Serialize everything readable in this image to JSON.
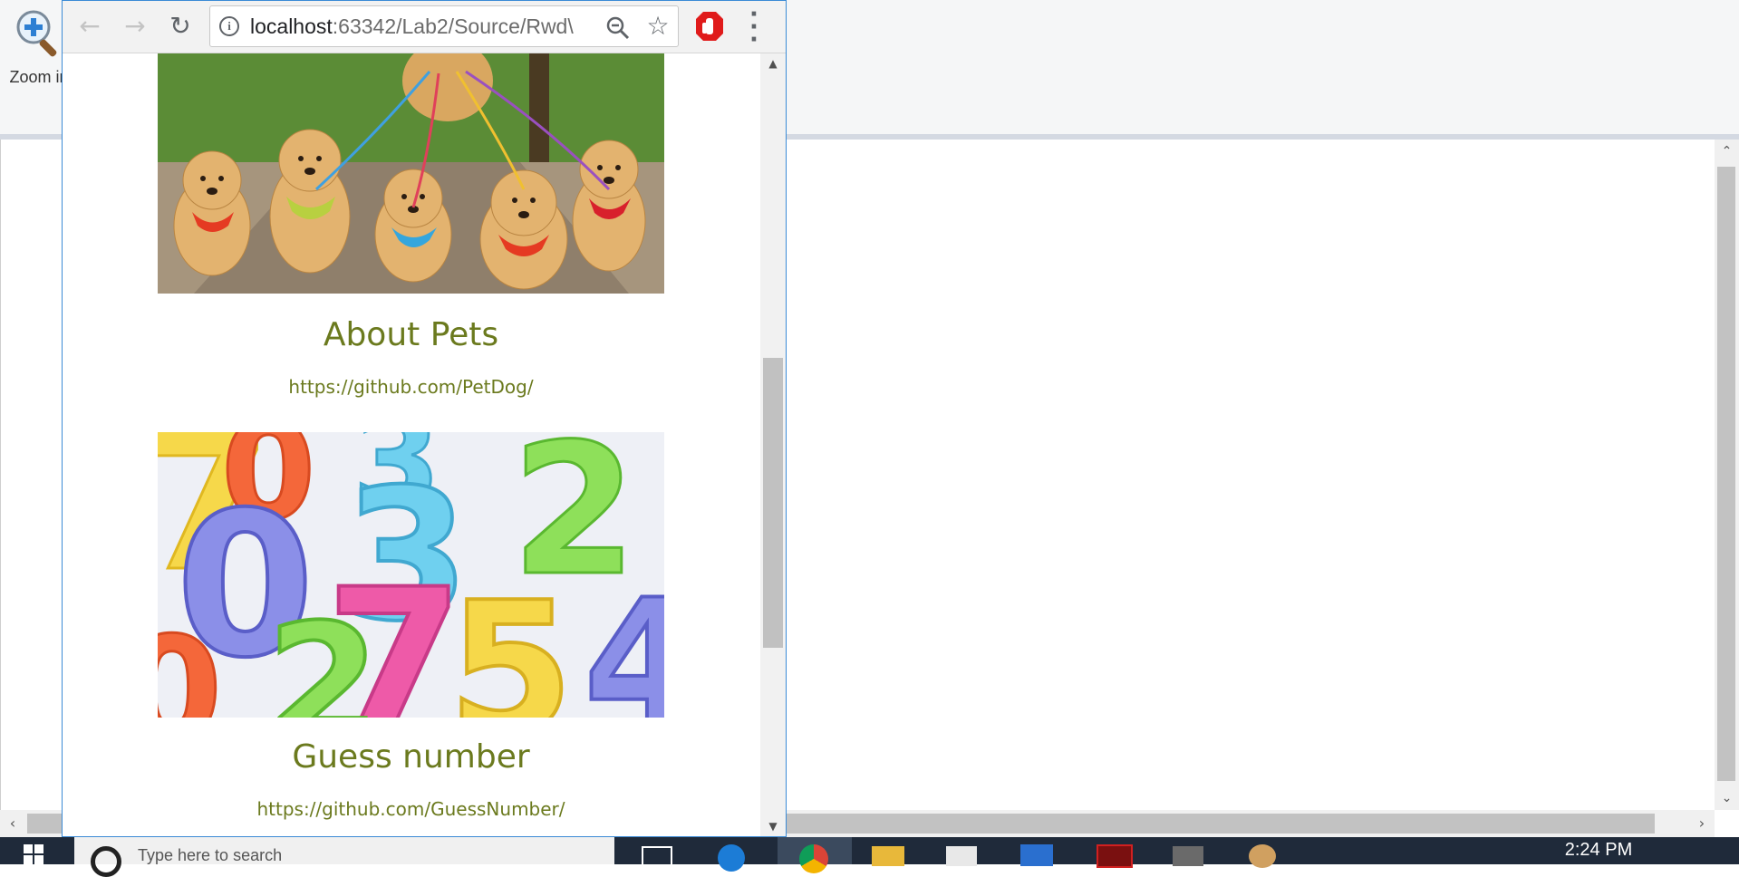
{
  "background_app": {
    "zoom_in_label": "Zoom in"
  },
  "browser": {
    "url_host": "localhost",
    "url_rest": ":63342/Lab2/Source/Rwd\\"
  },
  "projects": [
    {
      "title": "About Pets",
      "link": "https://github.com/PetDog/",
      "image_icon": "puppies-photo"
    },
    {
      "title": "Guess number",
      "link": "https://github.com/GuessNumber/",
      "image_icon": "colorful-numbers-photo"
    }
  ],
  "taskbar": {
    "search_placeholder": "Type here to search",
    "time": "2:24 PM"
  },
  "colors": {
    "accent_text": "#6b7a1e",
    "window_border": "#3b8bd6",
    "taskbar": "#1f2a3a"
  }
}
